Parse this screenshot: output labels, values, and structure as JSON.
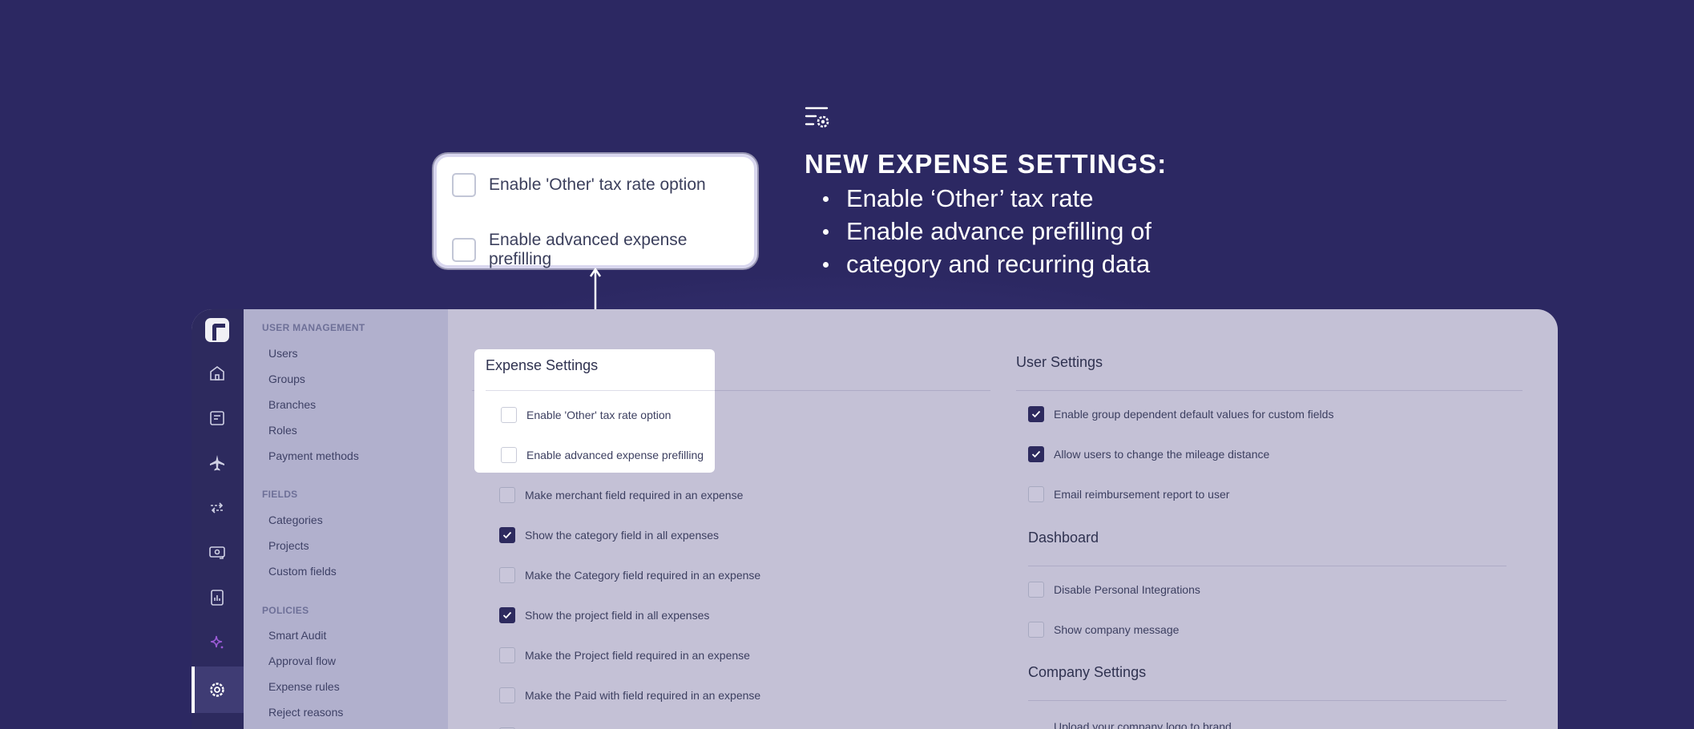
{
  "announcement": {
    "icon": "list-settings-icon",
    "heading": "NEW EXPENSE SETTINGS:",
    "bullets": [
      "Enable ‘Other’ tax rate",
      "Enable advance prefilling of",
      "category and recurring data"
    ]
  },
  "zoom_callout": {
    "items": [
      {
        "label": "Enable 'Other' tax rate option",
        "checked": false
      },
      {
        "label": "Enable advanced expense prefilling",
        "checked": false
      }
    ]
  },
  "sidebar": {
    "sections": [
      {
        "title": "USER MANAGEMENT",
        "items": [
          "Users",
          "Groups",
          "Branches",
          "Roles",
          "Payment methods"
        ]
      },
      {
        "title": "FIELDS",
        "items": [
          "Categories",
          "Projects",
          "Custom fields"
        ]
      },
      {
        "title": "POLICIES",
        "items": [
          "Smart Audit",
          "Approval flow",
          "Expense rules",
          "Reject reasons"
        ]
      }
    ]
  },
  "rail": {
    "icons": [
      "home-icon",
      "receipt-icon",
      "airplane-icon",
      "transfer-icon",
      "reimburse-icon",
      "report-chart-icon",
      "sparkle-icon",
      "settings-gear-icon"
    ],
    "active": "settings-gear-icon",
    "accent_color": "#9b5bd6"
  },
  "expense_settings": {
    "title": "Expense Settings",
    "highlighted": [
      {
        "label": "Enable 'Other' tax rate option",
        "checked": false
      },
      {
        "label": "Enable advanced expense prefilling",
        "checked": false
      }
    ],
    "items": [
      {
        "label": "Make merchant field required in an expense",
        "checked": false
      },
      {
        "label": "Show the category field in all expenses",
        "checked": true
      },
      {
        "label": "Make the Category field required in an expense",
        "checked": false
      },
      {
        "label": "Show the project field in all expenses",
        "checked": true
      },
      {
        "label": "Make the Project field required in an expense",
        "checked": false
      },
      {
        "label": "Make the Paid with field required in an expense",
        "checked": false
      }
    ]
  },
  "user_settings": {
    "title": "User Settings",
    "items": [
      {
        "label": "Enable group dependent default values for custom fields",
        "checked": true
      },
      {
        "label": "Allow users to change the mileage distance",
        "checked": true
      },
      {
        "label": "Email reimbursement report to user",
        "checked": false
      }
    ]
  },
  "dashboard": {
    "title": "Dashboard",
    "items": [
      {
        "label": "Disable Personal Integrations",
        "checked": false
      },
      {
        "label": "Show company message",
        "checked": false
      }
    ]
  },
  "company_settings": {
    "title": "Company Settings",
    "partial_text": "Upload your company logo to brand"
  }
}
